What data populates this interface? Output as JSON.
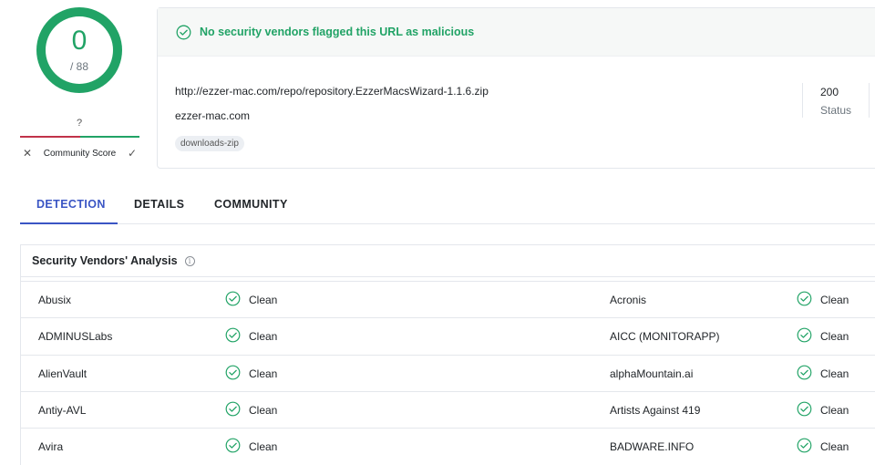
{
  "colors": {
    "clean_green": "#21a366",
    "malicious_red": "#c1334a",
    "accent_blue": "#3a55c4"
  },
  "score": {
    "detections": "0",
    "total": "/ 88"
  },
  "community": {
    "value": "?",
    "label": "Community Score",
    "down_icon": "x-icon",
    "up_icon": "check-icon"
  },
  "banner": {
    "icon": "check-circle-icon",
    "text": "No security vendors flagged this URL as malicious"
  },
  "url": {
    "full": "http://ezzer-mac.com/repo/repository.EzzerMacsWizard-1.1.6.zip",
    "domain": "ezzer-mac.com",
    "tag": "downloads-zip"
  },
  "status": {
    "code": "200",
    "label": "Status"
  },
  "tabs": {
    "detection": "DETECTION",
    "details": "DETAILS",
    "community": "COMMUNITY",
    "active": "detection"
  },
  "vendors": {
    "title": "Security Vendors' Analysis",
    "info_icon": "info-icon",
    "rows": [
      {
        "left_name": "Abusix",
        "left_result": "Clean",
        "right_name": "Acronis",
        "right_result": "Clean"
      },
      {
        "left_name": "ADMINUSLabs",
        "left_result": "Clean",
        "right_name": "AICC (MONITORAPP)",
        "right_result": "Clean"
      },
      {
        "left_name": "AlienVault",
        "left_result": "Clean",
        "right_name": "alphaMountain.ai",
        "right_result": "Clean"
      },
      {
        "left_name": "Antiy-AVL",
        "left_result": "Clean",
        "right_name": "Artists Against 419",
        "right_result": "Clean"
      },
      {
        "left_name": "Avira",
        "left_result": "Clean",
        "right_name": "BADWARE.INFO",
        "right_result": "Clean"
      }
    ]
  }
}
